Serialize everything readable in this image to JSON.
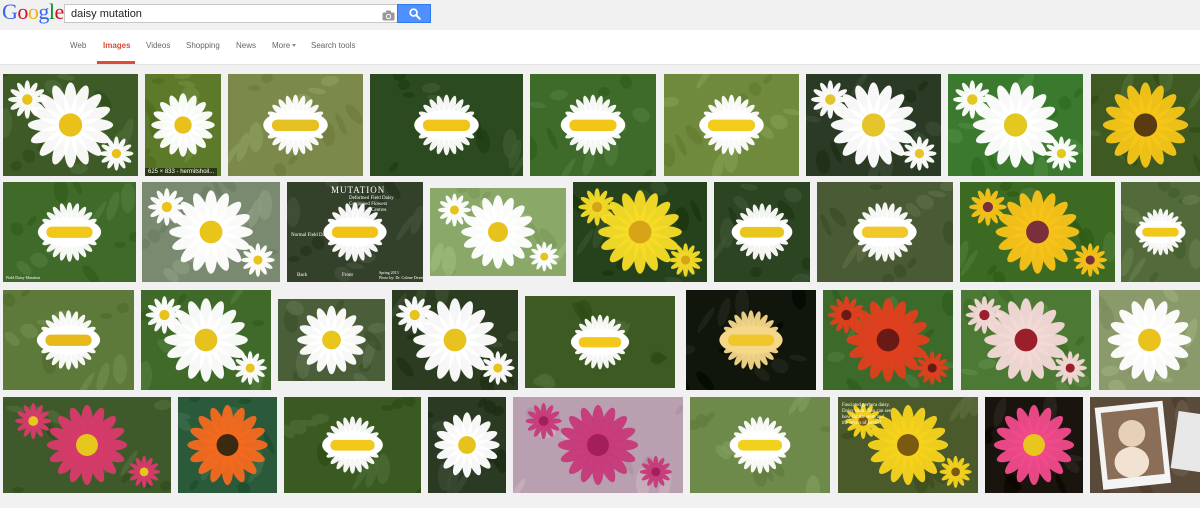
{
  "search": {
    "query": "daisy mutation"
  },
  "logo_letters": [
    {
      "ch": "G",
      "color": "#3369e8"
    },
    {
      "ch": "o",
      "color": "#d50f25"
    },
    {
      "ch": "o",
      "color": "#eeb211"
    },
    {
      "ch": "g",
      "color": "#3369e8"
    },
    {
      "ch": "l",
      "color": "#009925"
    },
    {
      "ch": "e",
      "color": "#d50f25"
    }
  ],
  "tabs": {
    "web": "Web",
    "images": "Images",
    "videos": "Videos",
    "shopping": "Shopping",
    "news": "News",
    "more": "More",
    "search_tools": "Search tools"
  },
  "hover_caption": "625 × 833 - hermitshoil...",
  "overlays": {
    "mutation_title": "MUTATION",
    "mutation_labels": "Deformed Field Daisy\nConjoined Flowers\n2 Stalks, 2 Centres",
    "mutation_normal": "Normal Field Daisy",
    "mutation_back": "Back",
    "mutation_front": "Front",
    "mutation_credit": "Spring 2013\nPhoto by: Dr. Colene Dexter",
    "row2_credit": "Field Daisy Mutation",
    "gerbera_text": "Fasciated gerbera daisy.\nDaisy stem! You can see\nhow far the stem and\nthe layers of petals!"
  },
  "images": [
    {
      "row": 1,
      "bg": "#3d5a27",
      "flower": "daisy",
      "center": "#e8c11a",
      "petal": "#ffffff"
    },
    {
      "row": 1,
      "bg": "#5c7a2a",
      "flower": "daisy",
      "center": "#e8c11a",
      "petal": "#ffffff"
    },
    {
      "row": 1,
      "bg": "#7b8a4a",
      "flower": "fasciated",
      "center": "#e5c021",
      "petal": "#ffffff"
    },
    {
      "row": 1,
      "bg": "#2c4a1f",
      "flower": "fasciated",
      "center": "#f0c419",
      "petal": "#ffffff"
    },
    {
      "row": 1,
      "bg": "#3e6a2a",
      "flower": "fasciated",
      "center": "#f2c517",
      "petal": "#ffffff"
    },
    {
      "row": 1,
      "bg": "#6f8a3c",
      "flower": "fasciated",
      "center": "#f3cb1a",
      "petal": "#ffffff"
    },
    {
      "row": 1,
      "bg": "#2a3a24",
      "flower": "daisy",
      "center": "#e6c52c",
      "petal": "#ffffff"
    },
    {
      "row": 1,
      "bg": "#3b7a2e",
      "flower": "daisy",
      "center": "#e3c81f",
      "petal": "#ffffff"
    },
    {
      "row": 1,
      "bg": "#3e5a22",
      "flower": "daisy",
      "center": "#5a3a10",
      "petal": "#f5c518"
    },
    {
      "row": 2,
      "bg": "#3f6a2a",
      "flower": "fasciated",
      "center": "#f1c81a",
      "petal": "#ffffff"
    },
    {
      "row": 2,
      "bg": "#7a8a70",
      "flower": "daisy",
      "center": "#e9c419",
      "petal": "#ffffff"
    },
    {
      "row": 2,
      "bg": "#33402a",
      "flower": "fasciated",
      "center": "#f1c316",
      "petal": "#ffffff"
    },
    {
      "row": 2,
      "bg": "#8aa868",
      "flower": "daisy",
      "center": "#e7c21d",
      "petal": "#ffffff"
    },
    {
      "row": 2,
      "bg": "#26421c",
      "flower": "daisy",
      "center": "#d6a319",
      "petal": "#f6dc26"
    },
    {
      "row": 2,
      "bg": "#2c4422",
      "flower": "fasciated",
      "center": "#e9c61d",
      "petal": "#ffffff"
    },
    {
      "row": 2,
      "bg": "#4a5a34",
      "flower": "fasciated",
      "center": "#f1c82a",
      "petal": "#ffffff"
    },
    {
      "row": 2,
      "bg": "#3c6a23",
      "flower": "daisy",
      "center": "#7a2f3b",
      "petal": "#f7c219"
    },
    {
      "row": 2,
      "bg": "#536b3a",
      "flower": "fasciated",
      "center": "#f1c81a",
      "petal": "#ffffff"
    },
    {
      "row": 3,
      "bg": "#5e7a3a",
      "flower": "fasciated",
      "center": "#e6b81a",
      "petal": "#ffffff"
    },
    {
      "row": 3,
      "bg": "#3f6a2a",
      "flower": "daisy",
      "center": "#e6c21e",
      "petal": "#ffffff"
    },
    {
      "row": 3,
      "bg": "#4a5e3a",
      "flower": "daisy",
      "center": "#e8c61c",
      "petal": "#ffffff"
    },
    {
      "row": 3,
      "bg": "#2c3c20",
      "flower": "daisy",
      "center": "#e9c31d",
      "petal": "#ffffff"
    },
    {
      "row": 3,
      "bg": "#3d5a22",
      "flower": "fasciated",
      "center": "#f2c81a",
      "petal": "#ffffff"
    },
    {
      "row": 3,
      "bg": "#10160c",
      "flower": "fasciated",
      "center": "#f1c62a",
      "petal": "#f5d78a"
    },
    {
      "row": 3,
      "bg": "#3b6a2a",
      "flower": "daisy",
      "center": "#6a1a15",
      "petal": "#e0401e"
    },
    {
      "row": 3,
      "bg": "#4c7a34",
      "flower": "daisy",
      "center": "#9a1f2a",
      "petal": "#f2d8d6"
    },
    {
      "row": 3,
      "bg": "#8a9a6a",
      "flower": "daisy",
      "center": "#e9c21d",
      "petal": "#ffffff"
    },
    {
      "row": 4,
      "bg": "#3f5a2a",
      "flower": "daisy",
      "center": "#e6c81d",
      "petal": "#d63a6a"
    },
    {
      "row": 4,
      "bg": "#2a5a3a",
      "flower": "daisy",
      "center": "#3a2a10",
      "petal": "#f26a1f"
    },
    {
      "row": 4,
      "bg": "#3a5a22",
      "flower": "fasciated",
      "center": "#f2c81a",
      "petal": "#ffffff"
    },
    {
      "row": 4,
      "bg": "#2b3a22",
      "flower": "daisy",
      "center": "#e7c21d",
      "petal": "#ffffff"
    },
    {
      "row": 4,
      "bg": "#b8a0b0",
      "flower": "daisy",
      "center": "#a31f5a",
      "petal": "#c83a7a"
    },
    {
      "row": 4,
      "bg": "#6e8a4a",
      "flower": "fasciated",
      "center": "#f1d11e",
      "petal": "#ffffff"
    },
    {
      "row": 4,
      "bg": "#4a5a2a",
      "flower": "daisy",
      "center": "#7a5a10",
      "petal": "#f6d21c"
    },
    {
      "row": 4,
      "bg": "#1a140e",
      "flower": "daisy",
      "center": "#e9c61d",
      "petal": "#f04a8a"
    },
    {
      "row": 4,
      "bg": "#5a4a3a",
      "flower": "photo",
      "center": "#e7d0b8",
      "petal": "#f2e2d2"
    }
  ]
}
